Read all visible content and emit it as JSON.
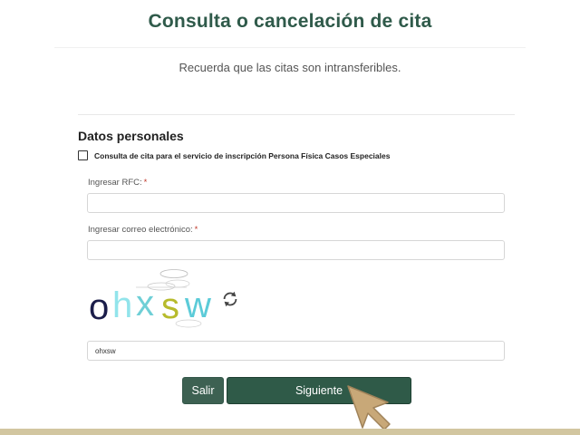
{
  "page": {
    "title": "Consulta o cancelación de cita",
    "subtitle": "Recuerda que las citas son intransferibles."
  },
  "form": {
    "section_title": "Datos personales",
    "checkbox_label": "Consulta de cita para el servicio de inscripción Persona Física Casos Especiales",
    "checkbox_checked": false,
    "rfc_label": "Ingresar RFC:",
    "rfc_value": "",
    "email_label": "Ingresar correo electrónico:",
    "email_value": "",
    "required_mark": "*",
    "captcha_text": "ohxsw",
    "captcha_input_value": "ohxsw",
    "refresh_icon": "refresh-icon"
  },
  "buttons": {
    "exit_label": "Salir",
    "next_label": "Siguiente"
  },
  "colors": {
    "brand_green": "#2f5a4a",
    "button_green": "#2f5a48",
    "accent_gold": "#d2c6a0",
    "required_red": "#c0392b"
  }
}
